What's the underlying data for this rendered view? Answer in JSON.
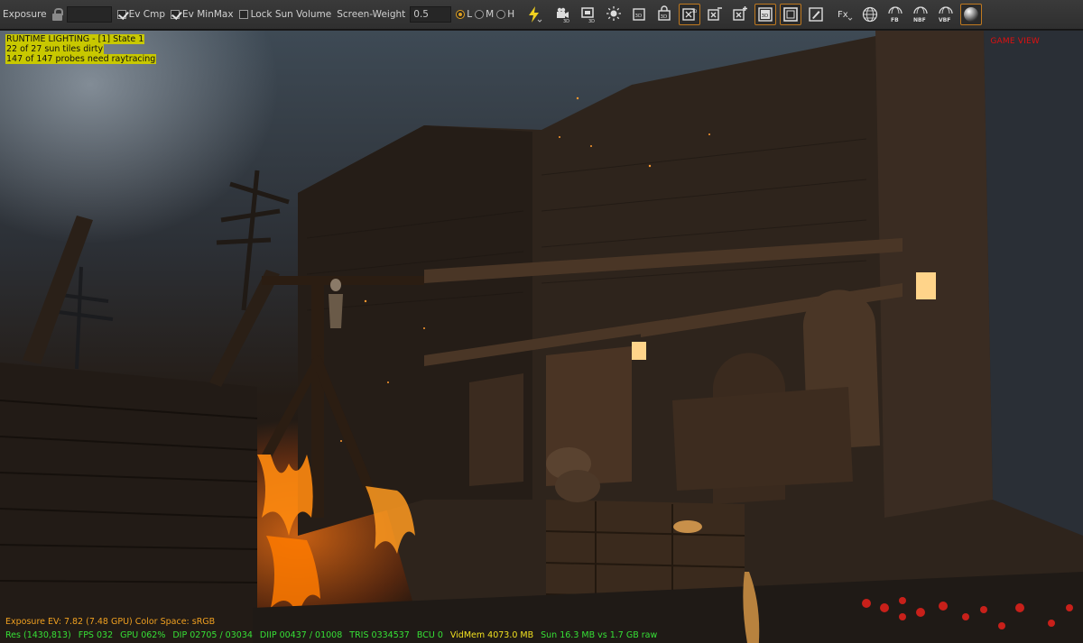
{
  "toolbar": {
    "exposure_label": "Exposure",
    "exposure_value": "",
    "ev_cmp": {
      "label": "Ev Cmp",
      "checked": true
    },
    "ev_minmax": {
      "label": "Ev MinMax",
      "checked": true
    },
    "lock_sun": {
      "label": "Lock Sun Volume",
      "checked": false
    },
    "screen_weight_label": "Screen-Weight",
    "screen_weight_value": "0.5",
    "quality": {
      "options": [
        "L",
        "M",
        "H"
      ],
      "selected": "L"
    },
    "icons": [
      "lightning-icon",
      "camera-3d-icon",
      "screenshot-3d-icon",
      "sun-light-icon",
      "box-3d-icon",
      "lock-3d-icon",
      "probe-3d-icon",
      "probe-minus-icon",
      "probe-plus-icon",
      "view-3d-icon",
      "frame-icon",
      "edit-icon",
      "fx-icon",
      "sphere-grid-icon",
      "fb-icon",
      "nbf-icon",
      "vbf-icon",
      "material-ball-icon"
    ],
    "fx_label": "Fx",
    "fb_label": "FB",
    "nbf_label": "NBF",
    "vbf_label": "VBF"
  },
  "hud": {
    "lines": [
      "RUNTIME LIGHTING - [1] State 1",
      "22 of 27 sun tiles dirty",
      "147 of 147 probes need raytracing"
    ],
    "game_view": "GAME VIEW",
    "exposure_line": "Exposure EV: 7.82 (7.48 GPU)  Color Space: sRGB"
  },
  "status": {
    "res": "Res (1430,813)",
    "fps": "FPS 032",
    "gpu": "GPU 062%",
    "dip": "DIP 02705 / 03034",
    "diip": "DIIP 00437 / 01008",
    "tris": "TRIS 0334537",
    "bcu": "BCU 0",
    "vidmem": "VidMem 4073.0 MB",
    "sun": "Sun 16.3 MB vs 1.7 GB raw"
  },
  "colors": {
    "hud_yellow": "#c8c800",
    "game_view_red": "#e01010",
    "status_green": "#36e036",
    "status_yellow": "#f0e020",
    "exposure_orange": "#f0a020",
    "active_border": "#c07a20"
  }
}
